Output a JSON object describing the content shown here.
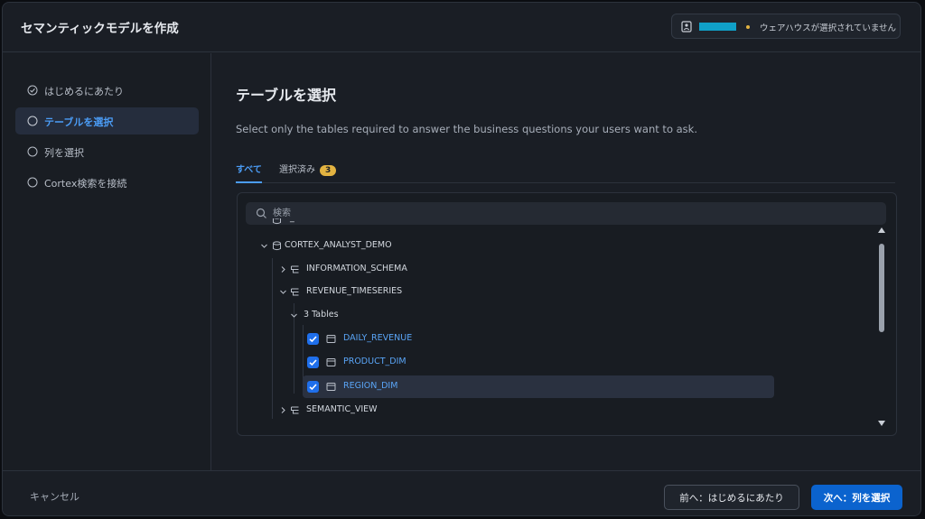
{
  "header": {
    "title": "セマンティックモデルを作成",
    "warehouse_status": "ウェアハウスが選択されていません",
    "status_dot_color": "#e3b341"
  },
  "sidebar": {
    "steps": [
      {
        "label": "はじめるにあたり",
        "icon": "check-circle-icon",
        "state": "done"
      },
      {
        "label": "テーブルを選択",
        "icon": "circle-icon",
        "state": "active"
      },
      {
        "label": "列を選択",
        "icon": "circle-icon",
        "state": "pending"
      },
      {
        "label": "Cortex検索を接続",
        "icon": "circle-icon",
        "state": "pending"
      }
    ]
  },
  "main": {
    "title": "テーブルを選択",
    "description": "Select only the tables required to answer the business questions your users want to ask.",
    "tabs": [
      {
        "label": "すべて",
        "active": true
      },
      {
        "label": "選択済み",
        "count": "3",
        "active": false
      }
    ],
    "search": {
      "placeholder": "検索"
    },
    "tree": {
      "truncated_row": "_",
      "database": "CORTEX_ANALYST_DEMO",
      "schemas": [
        {
          "name": "INFORMATION_SCHEMA",
          "expanded": false
        },
        {
          "name": "REVENUE_TIMESERIES",
          "expanded": true
        },
        {
          "name": "SEMANTIC_VIEW",
          "expanded": false
        }
      ],
      "group_label": "3 Tables",
      "tables": [
        {
          "name": "DAILY_REVENUE",
          "checked": true
        },
        {
          "name": "PRODUCT_DIM",
          "checked": true
        },
        {
          "name": "REGION_DIM",
          "checked": true,
          "highlighted": true
        }
      ]
    }
  },
  "footer": {
    "cancel_label": "キャンセル",
    "prev_label": "前へ：はじめるにあたり",
    "next_label": "次へ：列を選択"
  },
  "colors": {
    "accent": "#4b9cf5",
    "primary_button": "#0b63ce",
    "checkbox": "#1f6feb",
    "count_badge": "#e3b341",
    "redaction": "#10a0c8"
  }
}
